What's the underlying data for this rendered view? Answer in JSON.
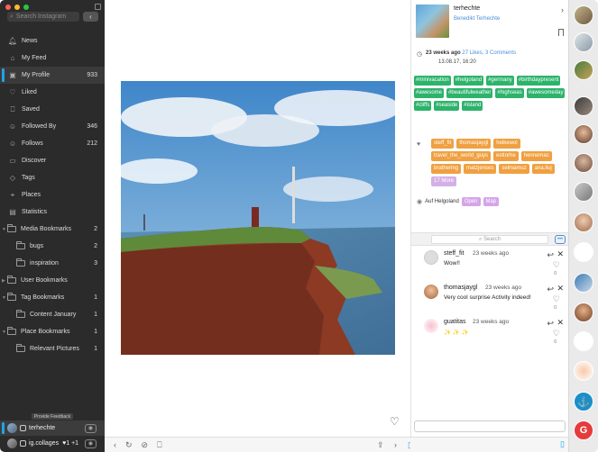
{
  "sidebar": {
    "search_placeholder": "Search Instagram",
    "back_symbol": "‹",
    "items": [
      {
        "label": "News",
        "icon": "bell-icon",
        "count": ""
      },
      {
        "label": "My Feed",
        "icon": "home-icon",
        "count": ""
      },
      {
        "label": "My Profile",
        "icon": "profile-icon",
        "count": "933"
      },
      {
        "label": "Liked",
        "icon": "heart-icon",
        "count": ""
      },
      {
        "label": "Saved",
        "icon": "bookmark-icon",
        "count": ""
      },
      {
        "label": "Followed By",
        "icon": "user-icon",
        "count": "346"
      },
      {
        "label": "Follows",
        "icon": "user-icon",
        "count": "212"
      },
      {
        "label": "Discover",
        "icon": "discover-icon",
        "count": ""
      },
      {
        "label": "Tags",
        "icon": "tag-icon",
        "count": ""
      },
      {
        "label": "Places",
        "icon": "pin-icon",
        "count": ""
      },
      {
        "label": "Statistics",
        "icon": "chart-icon",
        "count": ""
      },
      {
        "label": "Media Bookmarks",
        "icon": "folder-icon",
        "count": "2"
      },
      {
        "label": "bugs",
        "icon": "folder-icon",
        "count": "2"
      },
      {
        "label": "inspiration",
        "icon": "folder-icon",
        "count": "3"
      },
      {
        "label": "User Bookmarks",
        "icon": "folder-icon",
        "count": ""
      },
      {
        "label": "Tag Bookmarks",
        "icon": "folder-icon",
        "count": "1"
      },
      {
        "label": "Content January",
        "icon": "folder-icon",
        "count": "1"
      },
      {
        "label": "Place Bookmarks",
        "icon": "folder-icon",
        "count": "1"
      },
      {
        "label": "Relevant Pictures",
        "icon": "folder-icon",
        "count": "1"
      }
    ],
    "feedback_label": "Provide Feedback",
    "accounts": [
      {
        "name": "terhechte"
      },
      {
        "name": "ig.collages",
        "extra": "♥1  +1"
      }
    ]
  },
  "post": {
    "username": "terhechte",
    "fullname": "Benedikt Terhechte",
    "time_ago": "23 weeks ago",
    "likes": "27 Likes, 3 Comments",
    "date": "13.08.17, 16:20",
    "tags": [
      "#minivacation",
      "#helgoland",
      "#germany",
      "#birthdaypresent",
      "#awesome",
      "#beautifulweather",
      "#highseas",
      "#awesomeday",
      "#cliffs",
      "#seaside",
      "#island"
    ],
    "people": [
      "steff_fit",
      "thomasjaygl",
      "heikewol",
      "travel_the_world_guys",
      "esttorhe",
      "hennemac",
      "brathering",
      "matzjenses",
      "selmamuz",
      "ana.liuj",
      "17 More"
    ],
    "place": {
      "name": "Auf Helgoland",
      "open_label": "Open",
      "map_label": "Map"
    }
  },
  "comments": {
    "search_placeholder": "Search",
    "items": [
      {
        "user": "steff_fit",
        "time": "23 weeks ago",
        "text": "Wow!!",
        "likes": "0"
      },
      {
        "user": "thomasjaygl",
        "time": "23 weeks ago",
        "text": "Very cool surprise Activity indeed!",
        "likes": "0"
      },
      {
        "user": "guatitas",
        "time": "23 weeks ago",
        "text": "✨ ✨ ✨",
        "likes": "0"
      }
    ]
  },
  "colors": {
    "tag": "#2db36b",
    "person": "#f0a040",
    "accent": "#1fa3e8",
    "more": "#d4b0e6"
  }
}
